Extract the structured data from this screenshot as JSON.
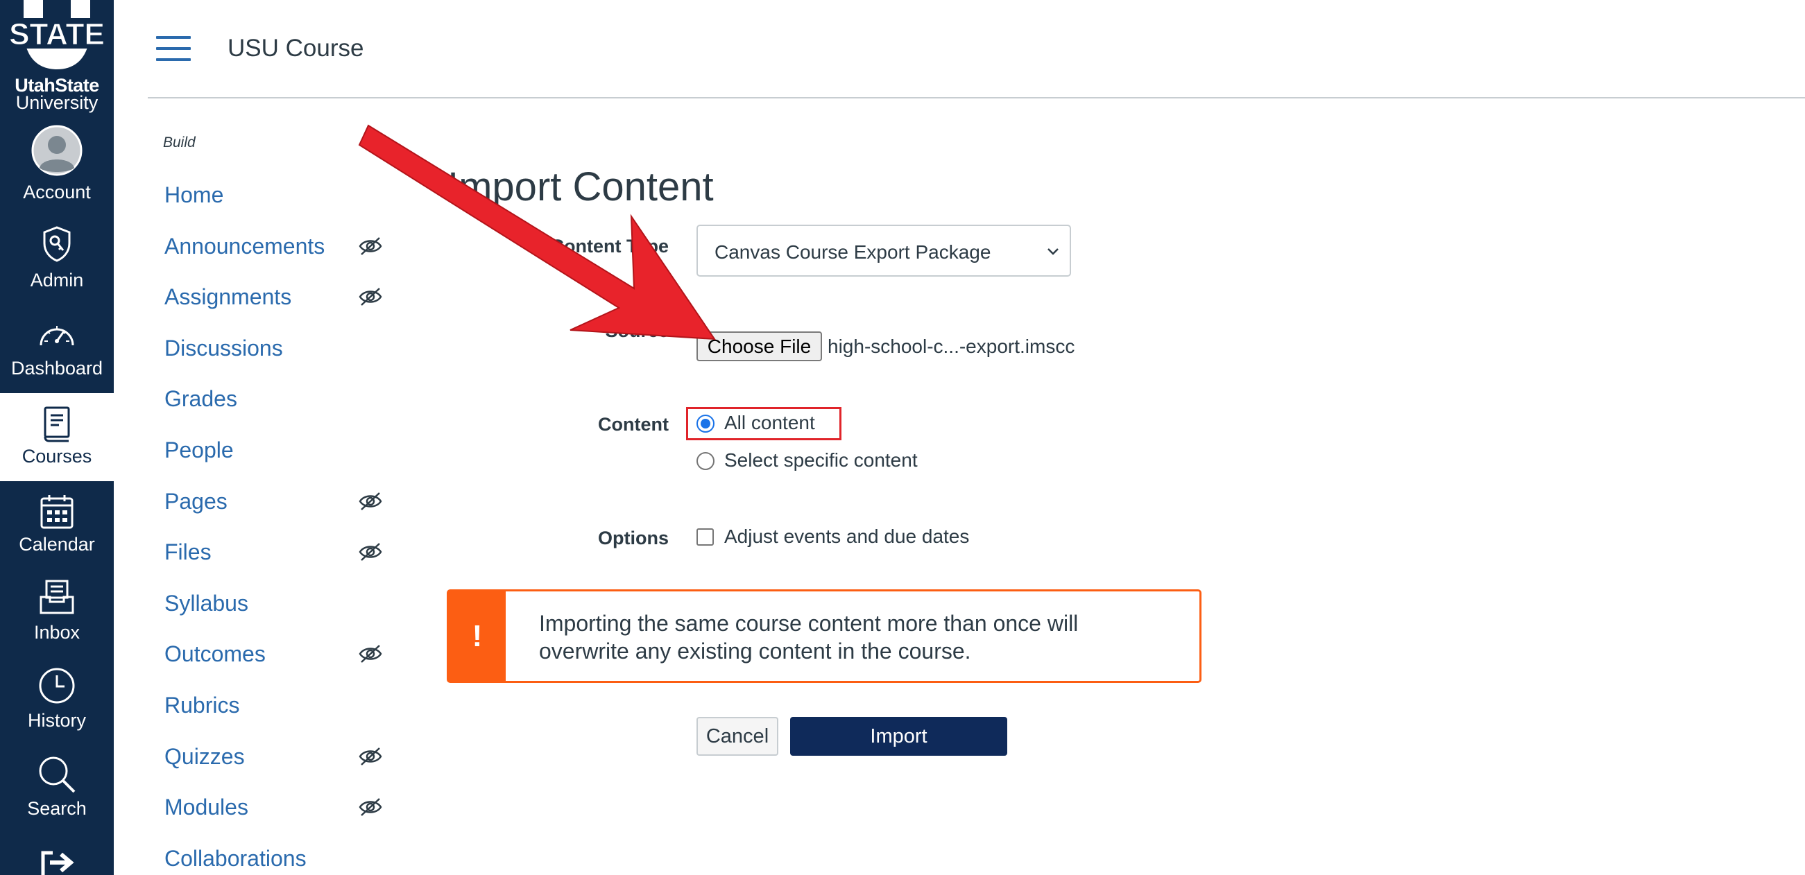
{
  "brand": {
    "logo_text": "STATE U",
    "university_line1": "UtahState",
    "university_line2": "University"
  },
  "global_nav": [
    {
      "label": "Account",
      "icon": "avatar-icon"
    },
    {
      "label": "Admin",
      "icon": "shield-key-icon"
    },
    {
      "label": "Dashboard",
      "icon": "speedometer-icon"
    },
    {
      "label": "Courses",
      "icon": "book-icon",
      "active": true
    },
    {
      "label": "Calendar",
      "icon": "calendar-icon"
    },
    {
      "label": "Inbox",
      "icon": "inbox-icon"
    },
    {
      "label": "History",
      "icon": "clock-icon"
    },
    {
      "label": "Search",
      "icon": "magnifier-icon"
    }
  ],
  "header": {
    "course_title": "USU Course"
  },
  "course_nav": {
    "section_label": "Build",
    "items": [
      {
        "label": "Home",
        "hidden_icon": false
      },
      {
        "label": "Announcements",
        "hidden_icon": true
      },
      {
        "label": "Assignments",
        "hidden_icon": true
      },
      {
        "label": "Discussions",
        "hidden_icon": false
      },
      {
        "label": "Grades",
        "hidden_icon": false
      },
      {
        "label": "People",
        "hidden_icon": false
      },
      {
        "label": "Pages",
        "hidden_icon": true
      },
      {
        "label": "Files",
        "hidden_icon": true
      },
      {
        "label": "Syllabus",
        "hidden_icon": false
      },
      {
        "label": "Outcomes",
        "hidden_icon": true
      },
      {
        "label": "Rubrics",
        "hidden_icon": false
      },
      {
        "label": "Quizzes",
        "hidden_icon": true
      },
      {
        "label": "Modules",
        "hidden_icon": true
      },
      {
        "label": "Collaborations",
        "hidden_icon": false
      }
    ]
  },
  "main": {
    "title": "Import Content",
    "content_type_label": "Content Type",
    "content_type_value": "Canvas Course Export Package",
    "source_label": "Source",
    "choose_file_label": "Choose File",
    "file_name": "high-school-c...-export.imscc",
    "content_label": "Content",
    "content_options": [
      "All content",
      "Select specific content"
    ],
    "content_selected": "All content",
    "options_label": "Options",
    "options_checkbox": "Adjust events and due dates",
    "alert_icon": "!",
    "alert_text": "Importing the same course content more than once will overwrite any existing content in the course.",
    "cancel_label": "Cancel",
    "import_label": "Import"
  },
  "colors": {
    "nav_bg": "#0f2a4a",
    "link": "#2a6aad",
    "warning": "#fc5e13",
    "primary_button": "#0f2a5a",
    "annotation_red": "#e0242a"
  }
}
